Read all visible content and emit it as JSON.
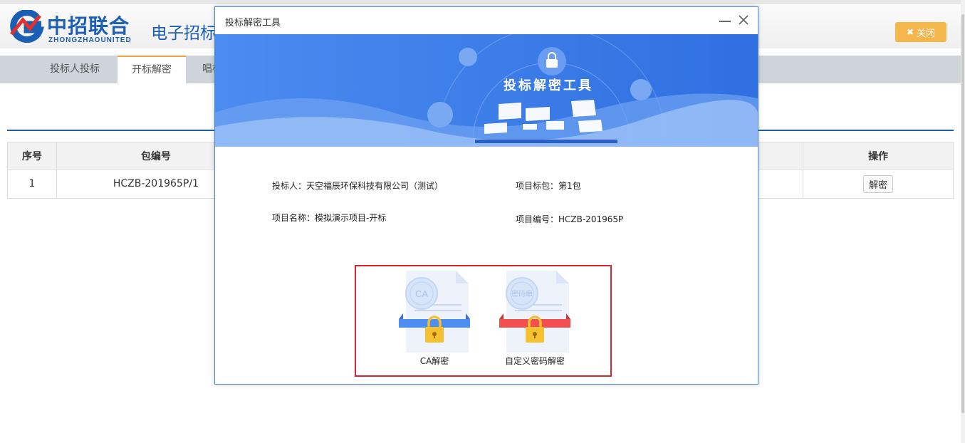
{
  "header": {
    "brand_cn": "中招联合",
    "brand_en": "ZHONGZHAOUNITED",
    "system_title": "电子招标投标交易平台",
    "close_label": "关闭"
  },
  "tabs": [
    {
      "label": "投标人投标"
    },
    {
      "label": "开标解密"
    },
    {
      "label": "唱标"
    }
  ],
  "table": {
    "headers": {
      "index": "序号",
      "package_no": "包编号",
      "action": "操作"
    },
    "rows": [
      {
        "index": "1",
        "package_no": "HCZB-201965P/1",
        "action_label": "解密"
      }
    ]
  },
  "modal": {
    "title": "投标解密工具",
    "banner_title": "投标解密工具",
    "bidder": "投标人：天空福辰环保科技有限公司（测试）",
    "package": "项目标包：第1包",
    "project_name": "项目名称：模拟演示项目-开标",
    "project_no": "项目编号：HCZB-201965P",
    "options": [
      {
        "label": "CA解密",
        "seal": "CA",
        "color": "#4d8ef0"
      },
      {
        "label": "自定义密码解密",
        "seal": "密码串",
        "color": "#f25050"
      }
    ]
  },
  "colors": {
    "brand": "#1b5fb5",
    "accent": "#f5b64b",
    "highlight": "#d9262e"
  }
}
